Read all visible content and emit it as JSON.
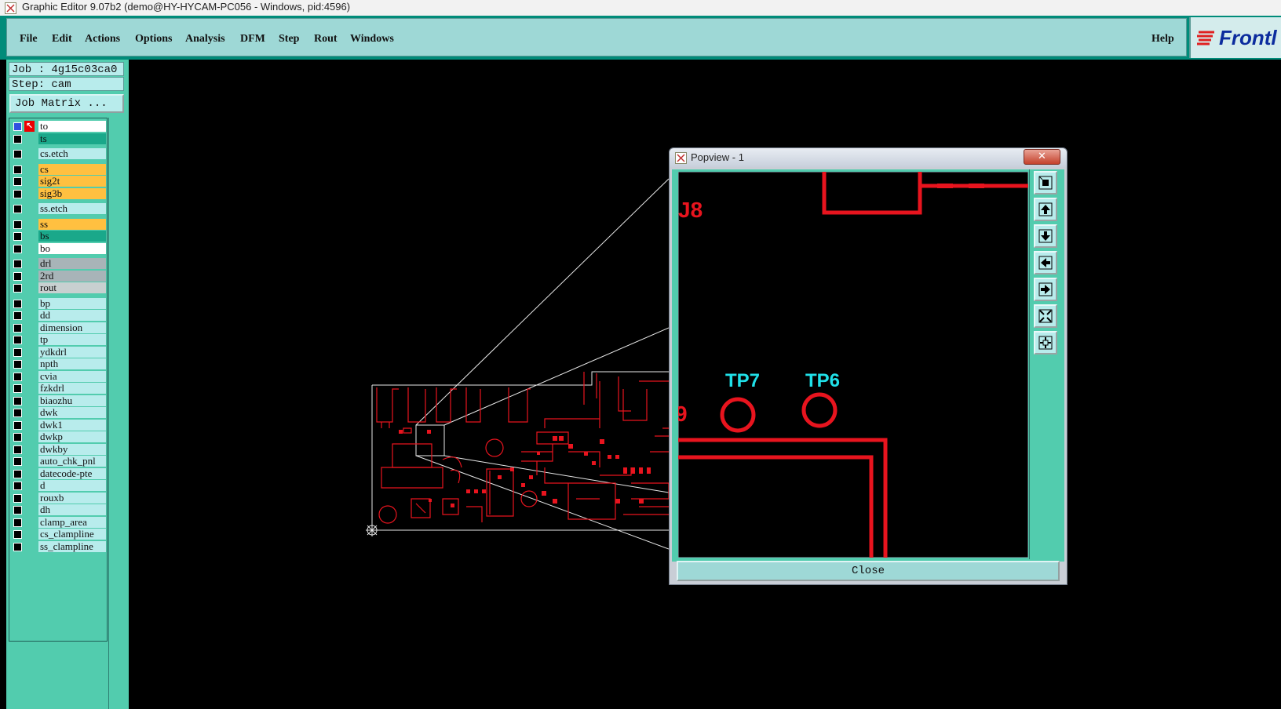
{
  "window": {
    "title": "Graphic Editor 9.07b2 (demo@HY-HYCAM-PC056 - Windows, pid:4596)"
  },
  "menu": {
    "items": [
      {
        "label": "File"
      },
      {
        "label": "Edit"
      },
      {
        "label": "Actions"
      },
      {
        "label": "Options"
      },
      {
        "label": "Analysis"
      },
      {
        "label": "DFM"
      },
      {
        "label": "Step"
      },
      {
        "label": "Rout"
      },
      {
        "label": "Windows"
      }
    ],
    "help": "Help",
    "logo": "Frontl"
  },
  "job": {
    "job_label": "Job : 4g15c03ca0",
    "step_label": "Step: cam",
    "matrix_button": "Job Matrix ..."
  },
  "layers": [
    {
      "name": "to",
      "color": "#ffffff",
      "selected": true
    },
    {
      "name": "ts",
      "color": "#1aa88a"
    },
    {
      "name": "cs.etch",
      "color": "#b8ecec"
    },
    {
      "name": "cs",
      "color": "#ffc040"
    },
    {
      "name": "sig2t",
      "color": "#ffc040"
    },
    {
      "name": "sig3b",
      "color": "#ffc040"
    },
    {
      "name": "ss.etch",
      "color": "#b8ecec"
    },
    {
      "name": "ss",
      "color": "#ffc040"
    },
    {
      "name": "bs",
      "color": "#1aa88a"
    },
    {
      "name": "bo",
      "color": "#ffffff"
    },
    {
      "name": "drl",
      "color": "#a8b4b8"
    },
    {
      "name": "2rd",
      "color": "#a8b4b8"
    },
    {
      "name": "rout",
      "color": "#c8d0d0"
    },
    {
      "name": "bp",
      "color": "#b8ecec"
    },
    {
      "name": "dd",
      "color": "#b8ecec"
    },
    {
      "name": "dimension",
      "color": "#b8ecec"
    },
    {
      "name": "tp",
      "color": "#b8ecec"
    },
    {
      "name": "ydkdrl",
      "color": "#b8ecec"
    },
    {
      "name": "npth",
      "color": "#b8ecec"
    },
    {
      "name": "cvia",
      "color": "#b8ecec"
    },
    {
      "name": "fzkdrl",
      "color": "#b8ecec"
    },
    {
      "name": "biaozhu",
      "color": "#b8ecec"
    },
    {
      "name": "dwk",
      "color": "#b8ecec"
    },
    {
      "name": "dwk1",
      "color": "#b8ecec"
    },
    {
      "name": "dwkp",
      "color": "#b8ecec"
    },
    {
      "name": "dwkby",
      "color": "#b8ecec"
    },
    {
      "name": "auto_chk_pnl",
      "color": "#b8ecec"
    },
    {
      "name": "datecode-pte",
      "color": "#b8ecec"
    },
    {
      "name": "d",
      "color": "#b8ecec"
    },
    {
      "name": "rouxb",
      "color": "#b8ecec"
    },
    {
      "name": "dh",
      "color": "#b8ecec"
    },
    {
      "name": "clamp_area",
      "color": "#b8ecec"
    },
    {
      "name": "cs_clampline",
      "color": "#b8ecec"
    },
    {
      "name": "ss_clampline",
      "color": "#b8ecec"
    }
  ],
  "popview": {
    "title": "Popview - 1",
    "close_button": "Close",
    "labels": {
      "u8": "J8",
      "tp7": "TP7",
      "tp6": "TP6",
      "nine": "9"
    }
  },
  "colors": {
    "trace": "#e8141e",
    "testpoint": "#20e0e8",
    "panel": "#52ccae",
    "menu": "#9ed8d6"
  }
}
